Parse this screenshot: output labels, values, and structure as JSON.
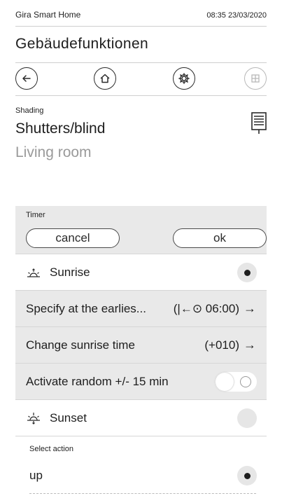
{
  "header": {
    "app_name": "Gira Smart Home",
    "datetime": "08:35 23/03/2020"
  },
  "page_title": "Gebäudefunktionen",
  "nav": {
    "buttons": [
      {
        "icon": "arrow-left-icon"
      },
      {
        "icon": "home-icon"
      },
      {
        "icon": "gear-icon"
      },
      {
        "icon": "grid-icon"
      }
    ]
  },
  "device": {
    "category": "Shading",
    "name": "Shutters/blind",
    "room": "Living room",
    "icon": "blind-icon"
  },
  "timer": {
    "header": "Timer",
    "cancel_label": "cancel",
    "ok_label": "ok",
    "sunrise_label": "Sunrise",
    "sunrise_selected": true,
    "earliest_label": "Specify at the earlies...",
    "earliest_value": "(|←⊙ 06:00)",
    "change_sunrise_label": "Change sunrise time",
    "change_sunrise_value": "(+010)",
    "random_label": "Activate random +/- 15 min",
    "random_on": false,
    "sunset_label": "Sunset",
    "sunset_selected": false,
    "arrow": "→",
    "select_action_label": "Select action",
    "action_up_label": "up",
    "action_up_selected": true
  },
  "colors": {
    "panel_grey": "#e9e9e9",
    "text": "#1e1e1e",
    "muted_text": "#9a9a9a"
  }
}
